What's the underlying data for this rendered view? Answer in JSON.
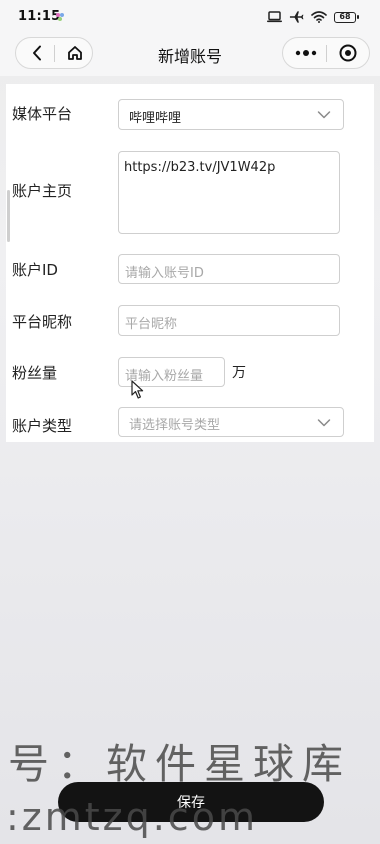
{
  "status_bar": {
    "time": "11:15",
    "battery": "68"
  },
  "nav": {
    "title": "新增账号"
  },
  "form": {
    "platform": {
      "label": "媒体平台",
      "value": "哔哩哔哩"
    },
    "homepage": {
      "label": "账户主页",
      "value": "https://b23.tv/JV1W42p"
    },
    "account_id": {
      "label": "账户ID",
      "placeholder": "请输入账号ID"
    },
    "nickname": {
      "label": "平台昵称",
      "placeholder": "平台昵称"
    },
    "followers": {
      "label": "粉丝量",
      "placeholder": "请输入粉丝量",
      "unit": "万"
    },
    "account_type": {
      "label": "账户类型",
      "placeholder": "请选择账号类型"
    }
  },
  "watermark": {
    "line1": "号：软件星球库",
    "line2": ":zmtzq.com"
  },
  "save_button": {
    "label": "保存"
  },
  "colors": {
    "save_button_bg": "#131313",
    "card_bg": "#ffffff",
    "border": "#cfcfcf",
    "placeholder": "#a8a8a8"
  }
}
